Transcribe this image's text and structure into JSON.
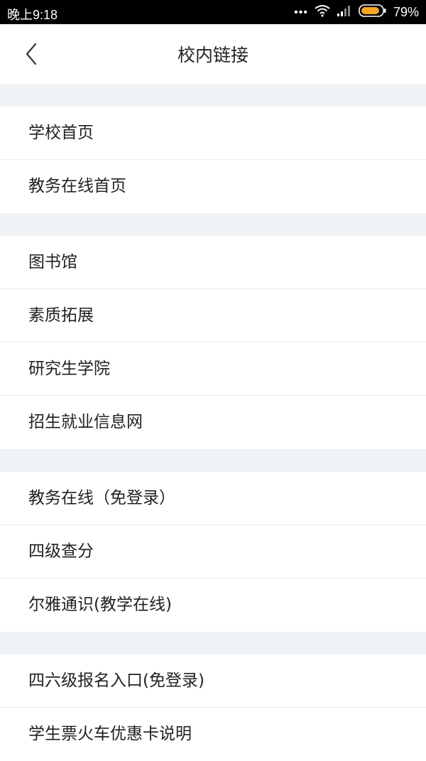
{
  "status_bar": {
    "time": "晚上9:18",
    "dots": "•••",
    "battery_percent": "79%",
    "icons": [
      "wifi-icon",
      "signal-icon",
      "battery-icon"
    ],
    "battery_color": "#f5a623"
  },
  "header": {
    "title": "校内链接",
    "back_icon": "chevron-left-icon"
  },
  "groups": [
    {
      "items": [
        {
          "label": "学校首页"
        },
        {
          "label": "教务在线首页"
        }
      ]
    },
    {
      "items": [
        {
          "label": "图书馆"
        },
        {
          "label": "素质拓展"
        },
        {
          "label": "研究生学院"
        },
        {
          "label": "招生就业信息网"
        }
      ]
    },
    {
      "items": [
        {
          "label": "教务在线（免登录）"
        },
        {
          "label": "四级查分"
        },
        {
          "label": "尔雅通识(教学在线)"
        }
      ]
    },
    {
      "items": [
        {
          "label": "四六级报名入口(免登录)"
        },
        {
          "label": "学生票火车优惠卡说明"
        }
      ]
    }
  ],
  "colors": {
    "background": "#f0f3f6",
    "row_background": "#ffffff",
    "text": "#222222",
    "divider": "#e8ebee"
  }
}
